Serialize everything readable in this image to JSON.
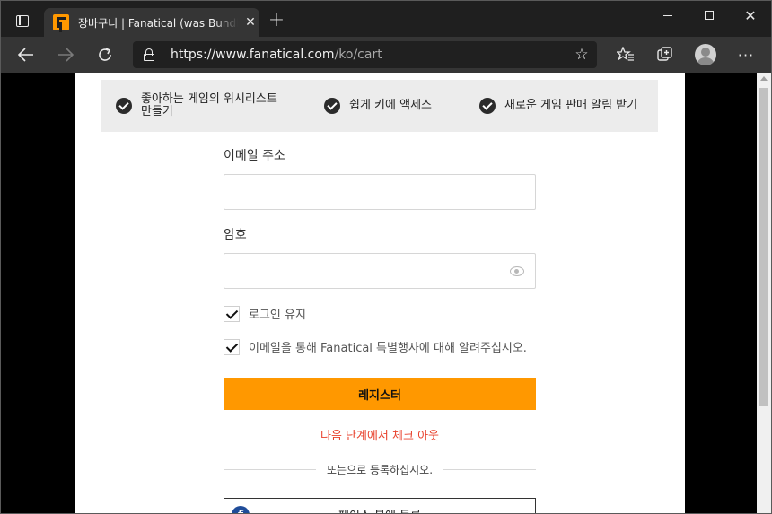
{
  "browser": {
    "tab_title": "장바구니 | Fanatical (was Bundle Stars)",
    "tab_close": "✕",
    "new_tab": "+",
    "url_host": "https://www.fanatical.com",
    "url_path": "/ko/cart",
    "window_close": "✕",
    "more_menu": "···"
  },
  "benefits": [
    {
      "text": "좋아하는 게임의 위시리스트 만들기"
    },
    {
      "text": "쉽게 키에 액세스"
    },
    {
      "text": "새로운 게임 판매 알림 받기"
    }
  ],
  "form": {
    "email_label": "이메일 주소",
    "email_value": "",
    "password_label": "암호",
    "password_value": "",
    "remember_label": "로그인 유지",
    "newsletter_label": "이메일을 통해 Fanatical 특별행사에 대해 알려주십시오.",
    "register_button": "레지스터",
    "checkout_link": "다음 단계에서 체크 아웃",
    "or_register": "또는으로 등록하십시오.",
    "facebook_button": "페이스 북에 등록"
  },
  "colors": {
    "accent": "#ff9800",
    "link_red": "#e8412c",
    "facebook": "#1f4c99"
  }
}
